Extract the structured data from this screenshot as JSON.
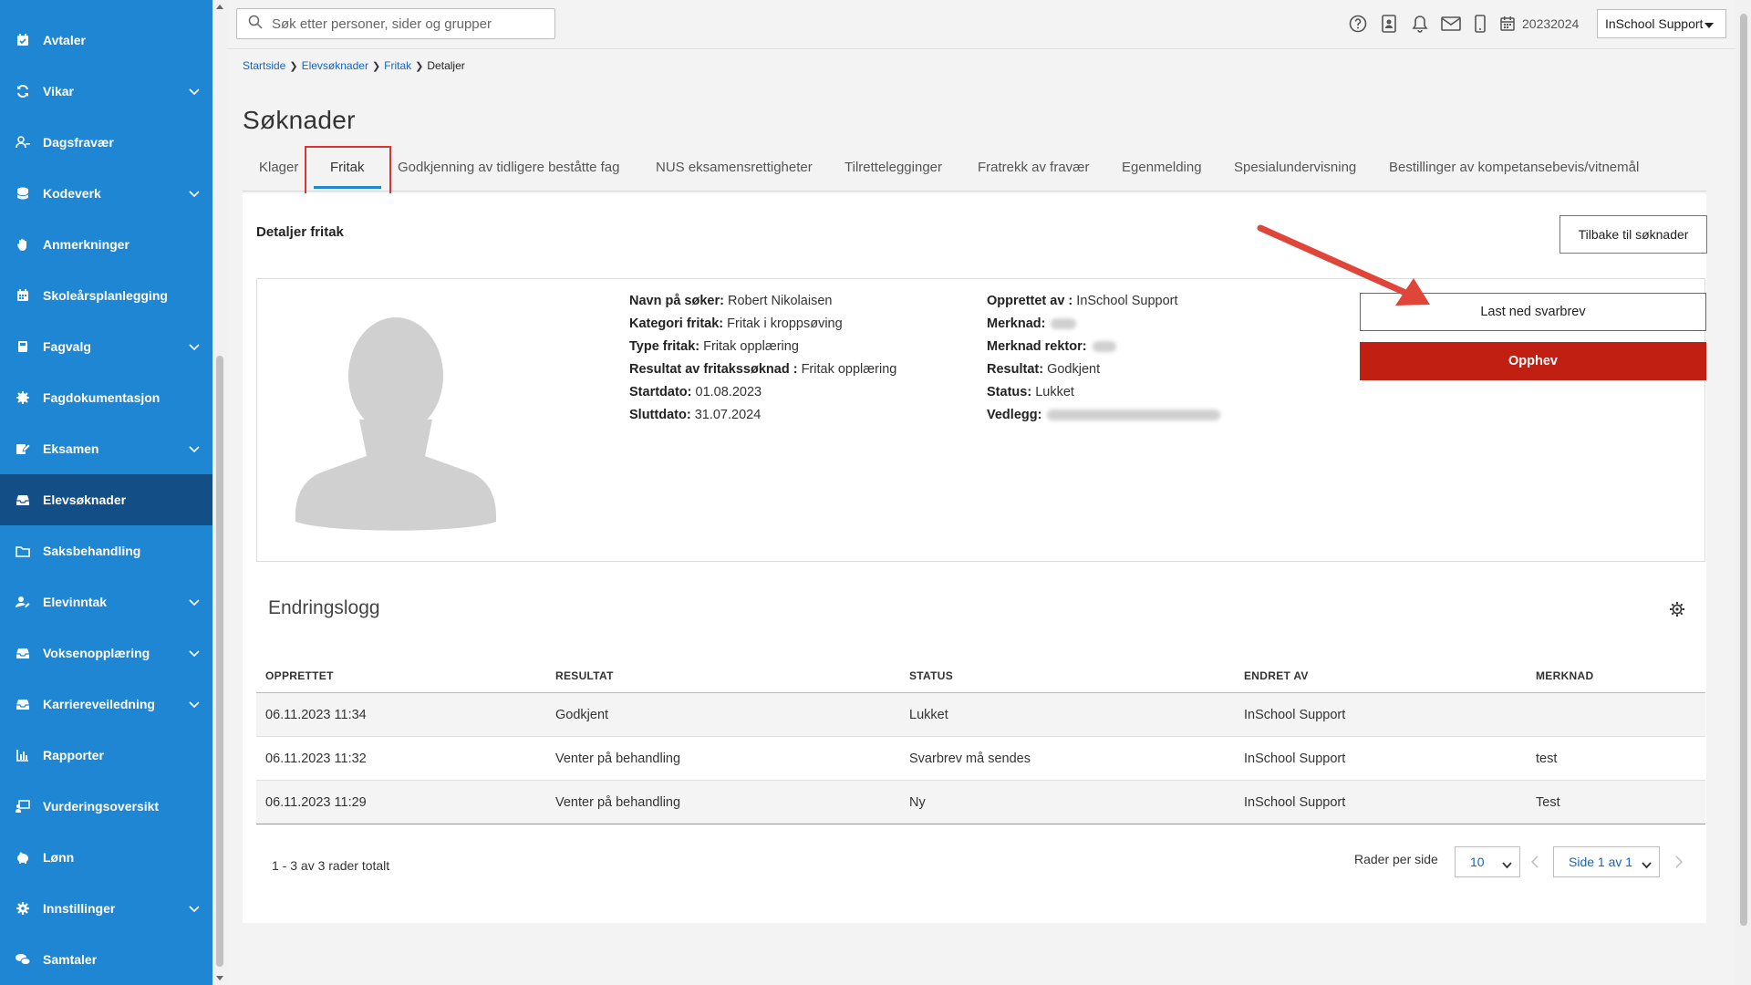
{
  "sidebar": {
    "items": [
      {
        "label": "Avtaler",
        "icon": "calendar-check-icon",
        "expandable": false
      },
      {
        "label": "Vikar",
        "icon": "refresh-icon",
        "expandable": true
      },
      {
        "label": "Dagsfravær",
        "icon": "user-minus-icon",
        "expandable": false
      },
      {
        "label": "Kodeverk",
        "icon": "database-icon",
        "expandable": true
      },
      {
        "label": "Anmerkninger",
        "icon": "hand-icon",
        "expandable": false
      },
      {
        "label": "Skoleårsplanlegging",
        "icon": "calendar-grid-icon",
        "expandable": false
      },
      {
        "label": "Fagvalg",
        "icon": "book-icon",
        "expandable": true
      },
      {
        "label": "Fagdokumentasjon",
        "icon": "cog-badge-icon",
        "expandable": false
      },
      {
        "label": "Eksamen",
        "icon": "edit-doc-icon",
        "expandable": true
      },
      {
        "label": "Elevsøknader",
        "icon": "inbox-icon",
        "expandable": false,
        "active": true
      },
      {
        "label": "Saksbehandling",
        "icon": "folder-icon",
        "expandable": false
      },
      {
        "label": "Elevinntak",
        "icon": "user-edit-icon",
        "expandable": true
      },
      {
        "label": "Voksenopplæring",
        "icon": "inbox-icon",
        "expandable": true
      },
      {
        "label": "Karriereveiledning",
        "icon": "inbox-icon",
        "expandable": true
      },
      {
        "label": "Rapporter",
        "icon": "bar-chart-icon",
        "expandable": false
      },
      {
        "label": "Vurderingsoversikt",
        "icon": "presentation-icon",
        "expandable": false
      },
      {
        "label": "Lønn",
        "icon": "piggy-bank-icon",
        "expandable": false
      },
      {
        "label": "Innstillinger",
        "icon": "gear-icon",
        "expandable": true
      },
      {
        "label": "Samtaler",
        "icon": "chat-icon",
        "expandable": false
      }
    ]
  },
  "header": {
    "search_placeholder": "Søk etter personer, sider og grupper",
    "school_year": "20232024",
    "user_menu": "InSchool Support"
  },
  "breadcrumb": {
    "items": [
      "Startside",
      "Elevsøknader",
      "Fritak"
    ],
    "current": "Detaljer"
  },
  "page_title": "Søknader",
  "tabs": [
    {
      "label": "Klager"
    },
    {
      "label": "Fritak",
      "active": true
    },
    {
      "label": "Godkjenning av tidligere beståtte fag"
    },
    {
      "label": "NUS eksamensrettigheter"
    },
    {
      "label": "Tilrettelegginger"
    },
    {
      "label": "Fratrekk av fravær"
    },
    {
      "label": "Egenmelding"
    },
    {
      "label": "Spesialundervisning"
    },
    {
      "label": "Bestillinger av kompetansebevis/vitnemål"
    }
  ],
  "details": {
    "section_title": "Detaljer fritak",
    "back_button": "Tilbake til søknader",
    "left_fields": [
      {
        "label": "Navn på søker:",
        "value": "Robert Nikolaisen"
      },
      {
        "label": "Kategori fritak:",
        "value": "Fritak i kroppsøving"
      },
      {
        "label": "Type fritak:",
        "value": "Fritak opplæring"
      },
      {
        "label": "Resultat av fritakssøknad :",
        "value": "Fritak opplæring"
      },
      {
        "label": "Startdato:",
        "value": "01.08.2023"
      },
      {
        "label": "Sluttdato:",
        "value": "31.07.2024"
      }
    ],
    "right_fields": [
      {
        "label": "Opprettet av :",
        "value": "InSchool Support"
      },
      {
        "label": "Merknad:",
        "value": "",
        "blurred": true
      },
      {
        "label": "Merknad rektor:",
        "value": "",
        "blurred": true
      },
      {
        "label": "Resultat:",
        "value": "Godkjent"
      },
      {
        "label": "Status:",
        "value": "Lukket"
      },
      {
        "label": "Vedlegg:",
        "value": "",
        "blurred": true
      }
    ],
    "download_button": "Last ned svarbrev",
    "revoke_button": "Opphev"
  },
  "changelog": {
    "title": "Endringslogg",
    "columns": [
      "OPPRETTET",
      "RESULTAT",
      "STATUS",
      "ENDRET AV",
      "MERKNAD"
    ],
    "rows": [
      [
        "06.11.2023 11:34",
        "Godkjent",
        "Lukket",
        "InSchool Support",
        ""
      ],
      [
        "06.11.2023 11:32",
        "Venter på behandling",
        "Svarbrev må sendes",
        "InSchool Support",
        "test"
      ],
      [
        "06.11.2023 11:29",
        "Venter på behandling",
        "Ny",
        "InSchool Support",
        "Test"
      ]
    ],
    "summary": "1 - 3 av 3 rader totalt",
    "rows_per_page_label": "Rader per side",
    "rows_per_page": "10",
    "page": "Side 1 av 1"
  },
  "colors": {
    "sidebar": "#1f86d3",
    "sidebar_active": "#134e87",
    "revoke": "#c01f12",
    "annotation": "#d93333"
  }
}
